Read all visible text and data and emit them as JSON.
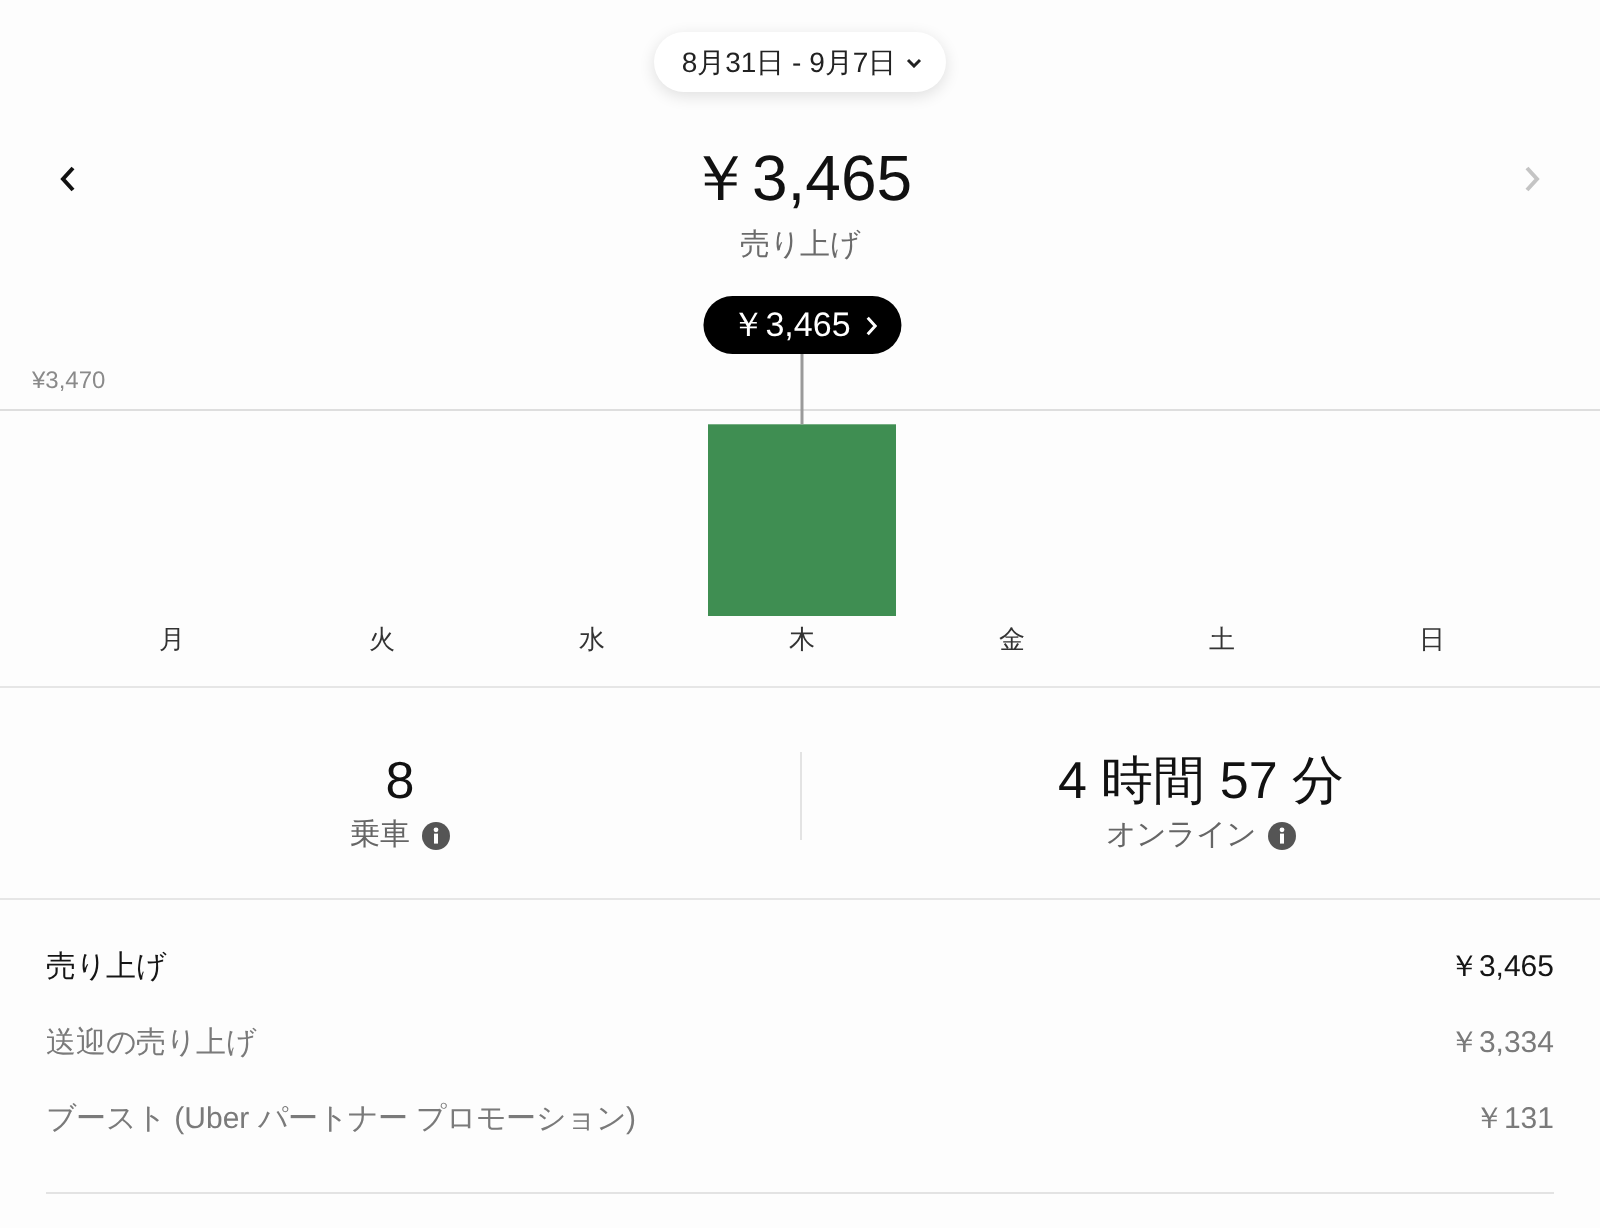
{
  "date_range": {
    "label": "8月31日 - 9月7日"
  },
  "navigation": {
    "previous": {
      "disabled": false
    },
    "next": {
      "disabled": true
    }
  },
  "summary": {
    "amount": "￥3,465",
    "label": "売り上げ"
  },
  "chart": {
    "max_label": "¥3,470",
    "chart_data": {
      "type": "bar",
      "categories": [
        "月",
        "火",
        "水",
        "木",
        "金",
        "土",
        "日"
      ],
      "values": [
        null,
        null,
        null,
        3465,
        null,
        null,
        null
      ],
      "value_labels": [
        null,
        null,
        null,
        "￥3,465",
        null,
        null,
        null
      ],
      "ylim": [
        0,
        3470
      ]
    }
  },
  "stats": [
    {
      "value": "8",
      "label": "乗車"
    },
    {
      "value": "4 時間 57 分",
      "label": "オンライン"
    }
  ],
  "breakdown": [
    {
      "kind": "total",
      "label": "売り上げ",
      "amount": "￥3,465"
    },
    {
      "kind": "item",
      "label": "送迎の売り上げ",
      "amount": "￥3,334"
    },
    {
      "kind": "item",
      "label": "ブースト (Uber パートナー プロモーション)",
      "amount": "￥131"
    }
  ]
}
